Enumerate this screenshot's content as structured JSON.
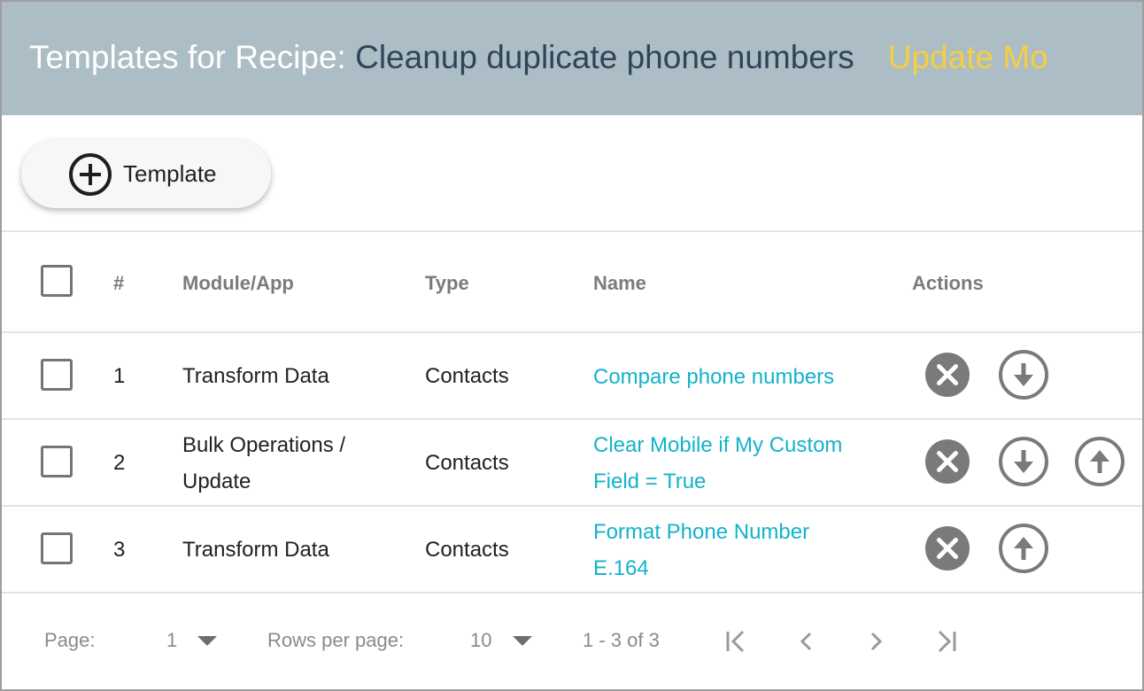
{
  "header": {
    "prefix": "Templates for Recipe: ",
    "recipe_name": "Cleanup duplicate phone numbers",
    "mode_label": "Update Mo"
  },
  "toolbar": {
    "add_template_label": "Template",
    "add_icon": "plus-circle-icon"
  },
  "table": {
    "columns": {
      "number": "#",
      "module": "Module/App",
      "type": "Type",
      "name": "Name",
      "actions": "Actions"
    },
    "rows": [
      {
        "number": "1",
        "module": [
          "Transform Data"
        ],
        "type": "Contacts",
        "name": [
          "Compare phone numbers"
        ],
        "actions": [
          "delete-icon",
          "download-icon"
        ]
      },
      {
        "number": "2",
        "module": [
          "Bulk Operations /",
          "Update"
        ],
        "type": "Contacts",
        "name": [
          "Clear Mobile if My Custom",
          "Field = True"
        ],
        "actions": [
          "delete-icon",
          "download-icon",
          "upload-icon"
        ]
      },
      {
        "number": "3",
        "module": [
          "Transform Data"
        ],
        "type": "Contacts",
        "name": [
          "Format Phone Number",
          "E.164"
        ],
        "actions": [
          "delete-icon",
          "upload-icon"
        ]
      }
    ]
  },
  "pagination": {
    "page_label": "Page:",
    "page_value": "1",
    "rows_label": "Rows per page:",
    "rows_value": "10",
    "range": "1 - 3 of 3"
  },
  "colors": {
    "header_bg": "#adbdc5",
    "recipe_name": "#2f4458",
    "mode": "#f5cf3d",
    "link": "#12b3cc",
    "action_icon": "#7a7a7a"
  }
}
